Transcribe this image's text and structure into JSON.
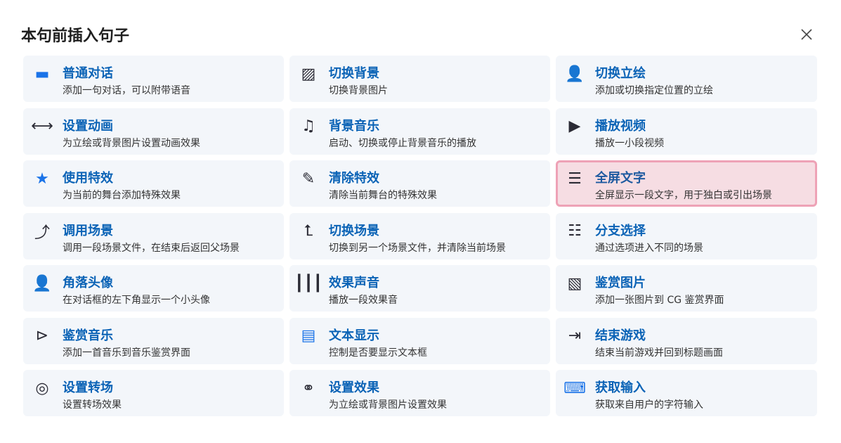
{
  "dialog": {
    "title": "本句前插入句子",
    "close_icon": "close-icon"
  },
  "items": [
    {
      "name": "普通对话",
      "desc": "添加一句对话，可以附带语音",
      "icon": "chat-bubble-icon",
      "glyph": "▬"
    },
    {
      "name": "切换背景",
      "desc": "切换背景图片",
      "icon": "image-icon",
      "glyph": "▨"
    },
    {
      "name": "切换立绘",
      "desc": "添加或切换指定位置的立绘",
      "icon": "person-icon",
      "glyph": "👤"
    },
    {
      "name": "设置动画",
      "desc": "为立绘或背景图片设置动画效果",
      "icon": "arrows-horizontal-icon",
      "glyph": "⟷"
    },
    {
      "name": "背景音乐",
      "desc": "启动、切换或停止背景音乐的播放",
      "icon": "music-note-icon",
      "glyph": "♫"
    },
    {
      "name": "播放视频",
      "desc": "播放一小段视频",
      "icon": "video-icon",
      "glyph": "▶"
    },
    {
      "name": "使用特效",
      "desc": "为当前的舞台添加特殊效果",
      "icon": "magic-star-icon",
      "glyph": "★"
    },
    {
      "name": "清除特效",
      "desc": "清除当前舞台的特殊效果",
      "icon": "eraser-icon",
      "glyph": "✎"
    },
    {
      "name": "全屏文字",
      "desc": "全屏显示一段文字，用于独白或引出场景",
      "icon": "text-lines-icon",
      "glyph": "☰"
    },
    {
      "name": "调用场景",
      "desc": "调用一段场景文件，在结束后返回父场景",
      "icon": "arrow-up-turn-icon",
      "glyph": "⤴"
    },
    {
      "name": "切换场景",
      "desc": "切换到另一个场景文件，并清除当前场景",
      "icon": "switch-scene-icon",
      "glyph": "⮤"
    },
    {
      "name": "分支选择",
      "desc": "通过选项进入不同的场景",
      "icon": "list-icon",
      "glyph": "☷"
    },
    {
      "name": "角落头像",
      "desc": "在对话框的左下角显示一个小头像",
      "icon": "avatar-icon",
      "glyph": "👤"
    },
    {
      "name": "效果声音",
      "desc": "播放一段效果音",
      "icon": "sound-wave-icon",
      "glyph": "┃┃┃"
    },
    {
      "name": "鉴赏图片",
      "desc": "添加一张图片到 CG 鉴赏界面",
      "icon": "image-add-icon",
      "glyph": "▧"
    },
    {
      "name": "鉴赏音乐",
      "desc": "添加一首音乐到音乐鉴赏界面",
      "icon": "play-circle-add-icon",
      "glyph": "⊳"
    },
    {
      "name": "文本显示",
      "desc": "控制是否要显示文本框",
      "icon": "textbox-icon",
      "glyph": "▤"
    },
    {
      "name": "结束游戏",
      "desc": "结束当前游戏并回到标题画面",
      "icon": "exit-icon",
      "glyph": "⇥"
    },
    {
      "name": "设置转场",
      "desc": "设置转场效果",
      "icon": "transition-icon",
      "glyph": "◎"
    },
    {
      "name": "设置效果",
      "desc": "为立绘或背景图片设置效果",
      "icon": "color-circles-icon",
      "glyph": "⚭"
    },
    {
      "name": "获取输入",
      "desc": "获取来自用户的字符输入",
      "icon": "keyboard-icon",
      "glyph": "⌨"
    }
  ],
  "selected_index": 8
}
